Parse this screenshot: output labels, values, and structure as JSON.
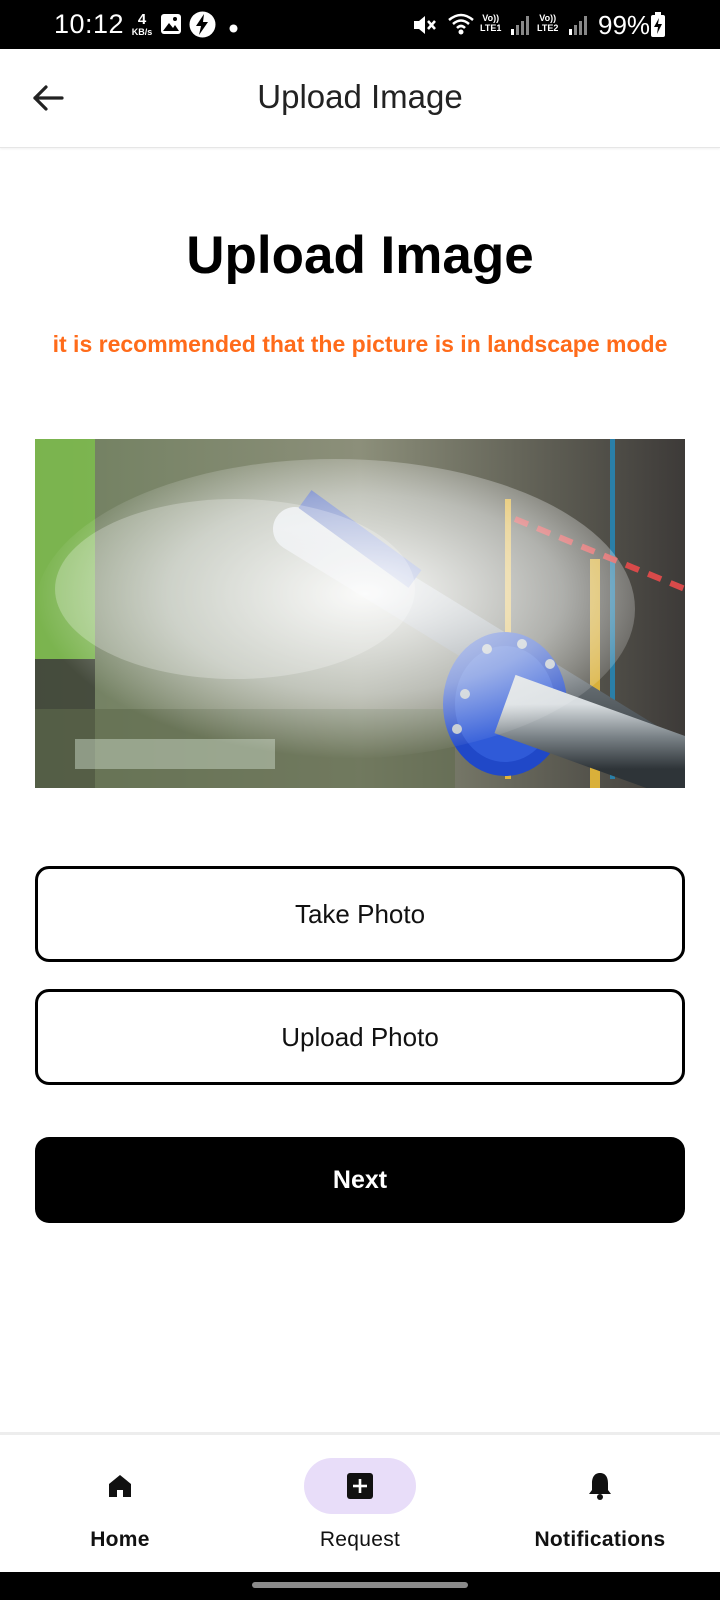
{
  "status_bar": {
    "time": "10:12",
    "net_speed_value": "4",
    "net_speed_unit": "KB/s",
    "battery": "99%",
    "lte1": "LTE1",
    "lte2": "LTE2",
    "volte": "Vo))",
    "icons": [
      "image-icon",
      "bolt-icon",
      "dot-icon",
      "mute-icon",
      "wifi-icon",
      "signal-icon",
      "battery-icon"
    ]
  },
  "app_bar": {
    "title": "Upload Image"
  },
  "main": {
    "heading": "Upload Image",
    "hint": "it is recommended that the picture is in landscape mode",
    "take_photo_label": "Take Photo",
    "upload_photo_label": "Upload Photo",
    "next_label": "Next"
  },
  "bottom_nav": {
    "items": [
      {
        "label": "Home",
        "icon": "home-icon",
        "active": false
      },
      {
        "label": "Request",
        "icon": "add-box-icon",
        "active": true
      },
      {
        "label": "Notifications",
        "icon": "bell-icon",
        "active": false
      }
    ]
  },
  "colors": {
    "hint": "#ff6b1a",
    "primary_button": "#000000",
    "active_nav_pill": "#e8ddf9"
  }
}
